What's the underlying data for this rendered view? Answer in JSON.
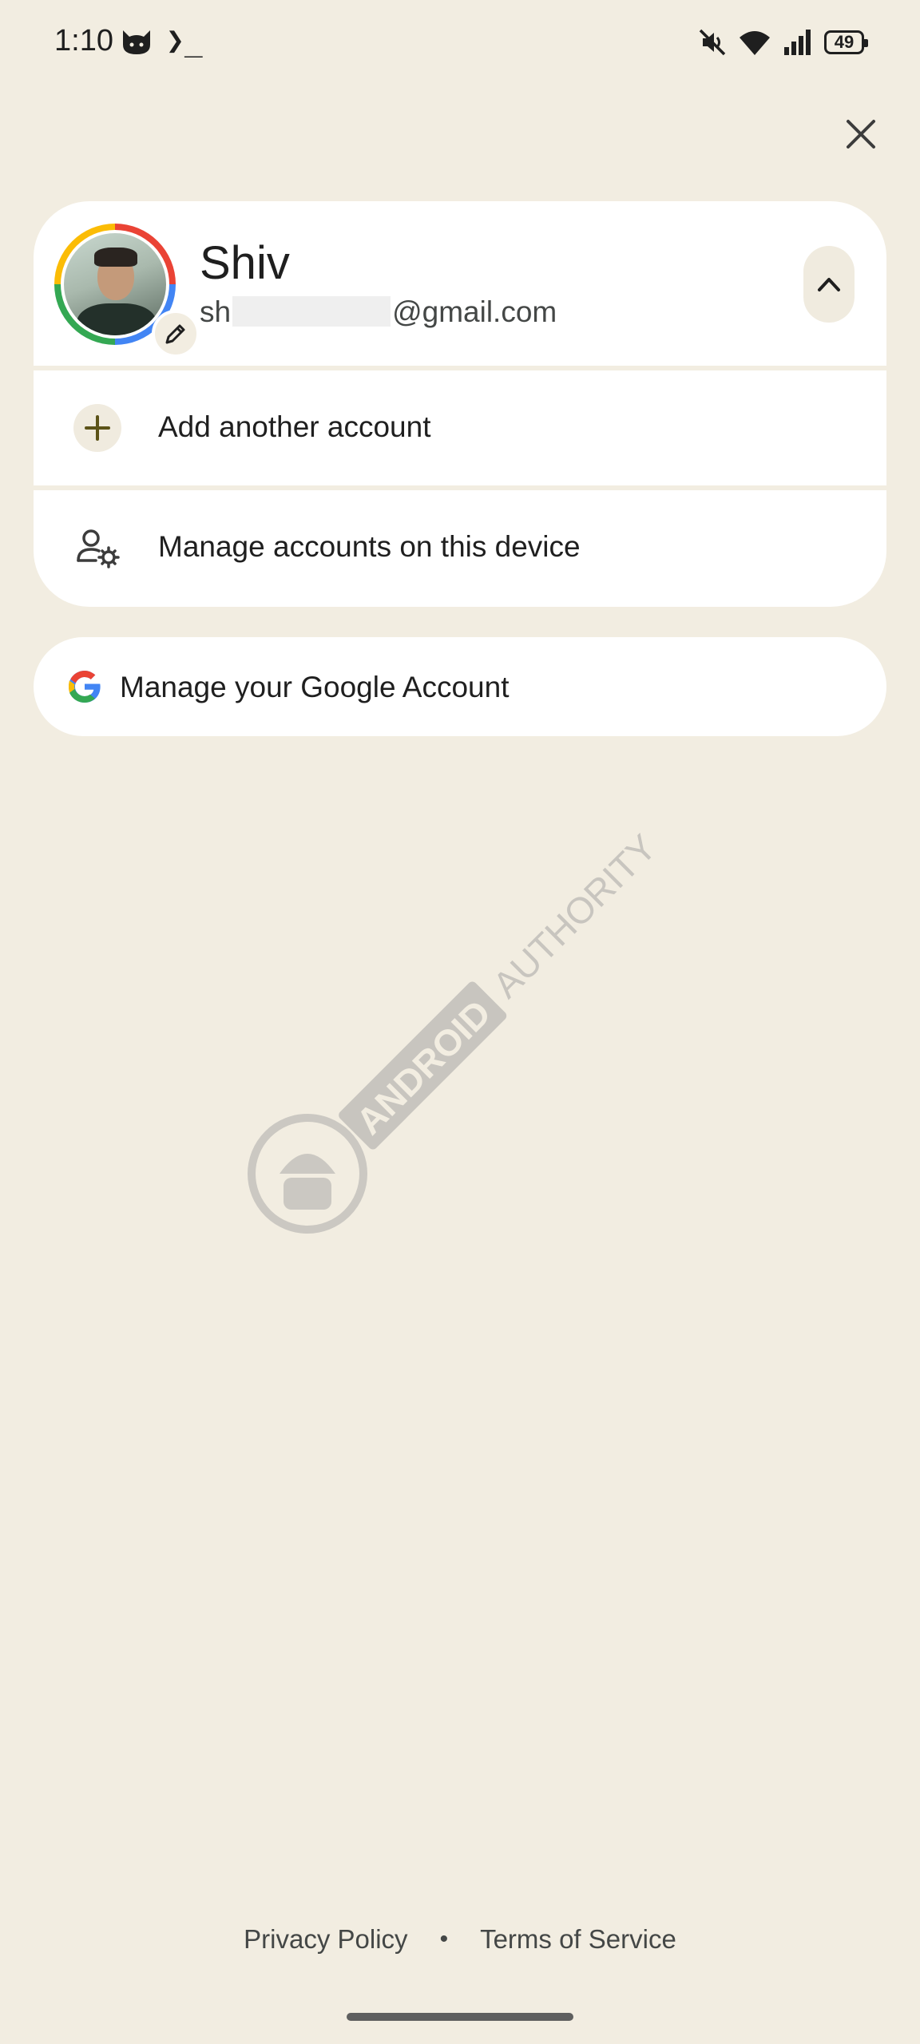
{
  "status_bar": {
    "time": "1:10",
    "terminal_glyph": "❯_",
    "battery": "49",
    "icons": [
      "cat-icon",
      "terminal-icon",
      "mute-icon",
      "wifi-icon",
      "signal-icon",
      "battery-icon"
    ]
  },
  "account": {
    "name": "Shiv",
    "email_prefix": "sh",
    "email_suffix": "@gmail.com"
  },
  "menu": {
    "add_account": "Add another account",
    "manage_devices": "Manage accounts on this device"
  },
  "google_account": {
    "label": "Manage your Google Account"
  },
  "watermark": {
    "text_bold": "ANDROID",
    "text_light": "AUTHORITY"
  },
  "footer": {
    "privacy": "Privacy Policy",
    "separator": "•",
    "terms": "Terms of Service"
  },
  "colors": {
    "background": "#f2ede1",
    "card": "#ffffff",
    "accent_olive": "#5c5318"
  }
}
